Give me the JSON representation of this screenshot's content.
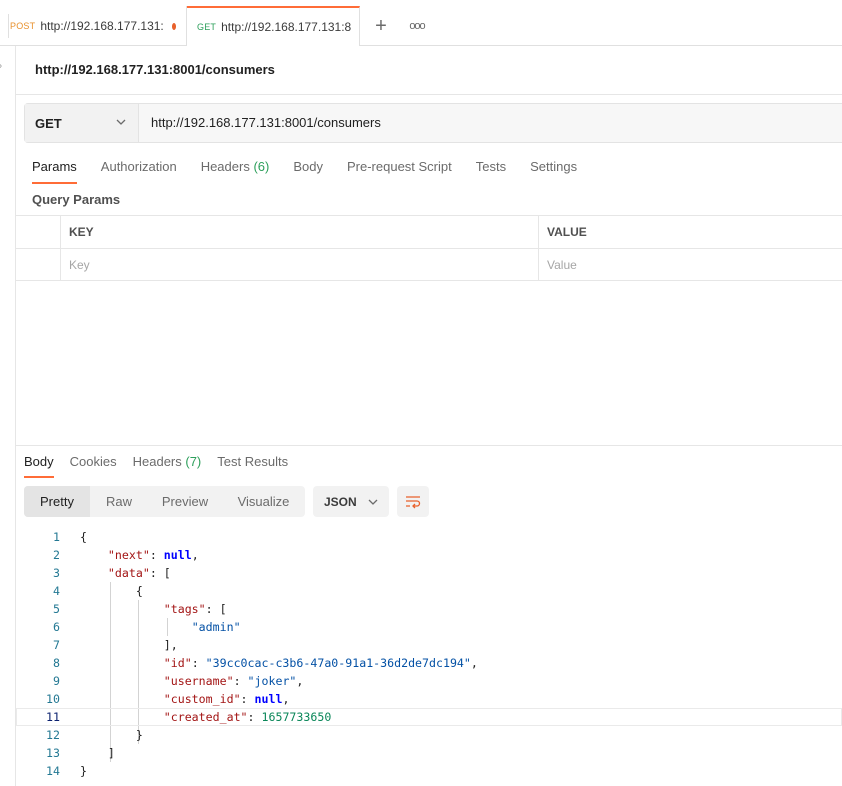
{
  "tabs": [
    {
      "method": "POST",
      "url": "http://192.168.177.131:",
      "unsaved": true
    },
    {
      "method": "GET",
      "url": "http://192.168.177.131:8",
      "unsaved": true
    }
  ],
  "tab_add_label": "+",
  "tab_more_label": "ooo",
  "request": {
    "title": "http://192.168.177.131:8001/consumers",
    "method": "GET",
    "url": "http://192.168.177.131:8001/consumers"
  },
  "request_tabs": {
    "params": "Params",
    "authorization": "Authorization",
    "headers": "Headers",
    "headers_count": "(6)",
    "body": "Body",
    "prerequest": "Pre-request Script",
    "tests": "Tests",
    "settings": "Settings"
  },
  "query_params": {
    "label": "Query Params",
    "key_header": "KEY",
    "value_header": "VALUE",
    "key_placeholder": "Key",
    "value_placeholder": "Value"
  },
  "response_tabs": {
    "body": "Body",
    "cookies": "Cookies",
    "headers": "Headers",
    "headers_count": "(7)",
    "test_results": "Test Results"
  },
  "view_modes": {
    "pretty": "Pretty",
    "raw": "Raw",
    "preview": "Preview",
    "visualize": "Visualize"
  },
  "format": "JSON",
  "colors": {
    "accent": "#ff6c37",
    "get": "#2d9f5b",
    "post": "#e8912d",
    "json_key": "#a31515",
    "json_string": "#0451a5",
    "json_number": "#098658",
    "json_keyword": "#0000ff"
  },
  "response_lines": [
    {
      "n": "1",
      "indent": "",
      "parts": [
        [
          "p",
          "{"
        ]
      ]
    },
    {
      "n": "2",
      "indent": "    ",
      "parts": [
        [
          "k",
          "\"next\""
        ],
        [
          "p",
          ": "
        ],
        [
          "kw",
          "null"
        ],
        [
          "p",
          ","
        ]
      ]
    },
    {
      "n": "3",
      "indent": "    ",
      "parts": [
        [
          "k",
          "\"data\""
        ],
        [
          "p",
          ": ["
        ]
      ]
    },
    {
      "n": "4",
      "indent": "        ",
      "parts": [
        [
          "p",
          "{"
        ]
      ]
    },
    {
      "n": "5",
      "indent": "            ",
      "parts": [
        [
          "k",
          "\"tags\""
        ],
        [
          "p",
          ": ["
        ]
      ]
    },
    {
      "n": "6",
      "indent": "                ",
      "parts": [
        [
          "s",
          "\"admin\""
        ]
      ]
    },
    {
      "n": "7",
      "indent": "            ",
      "parts": [
        [
          "p",
          "],"
        ]
      ]
    },
    {
      "n": "8",
      "indent": "            ",
      "parts": [
        [
          "k",
          "\"id\""
        ],
        [
          "p",
          ": "
        ],
        [
          "s",
          "\"39cc0cac-c3b6-47a0-91a1-36d2de7dc194\""
        ],
        [
          "p",
          ","
        ]
      ]
    },
    {
      "n": "9",
      "indent": "            ",
      "parts": [
        [
          "k",
          "\"username\""
        ],
        [
          "p",
          ": "
        ],
        [
          "s",
          "\"joker\""
        ],
        [
          "p",
          ","
        ]
      ]
    },
    {
      "n": "10",
      "indent": "            ",
      "parts": [
        [
          "k",
          "\"custom_id\""
        ],
        [
          "p",
          ": "
        ],
        [
          "kw",
          "null"
        ],
        [
          "p",
          ","
        ]
      ]
    },
    {
      "n": "11",
      "indent": "            ",
      "parts": [
        [
          "k",
          "\"created_at\""
        ],
        [
          "p",
          ": "
        ],
        [
          "n",
          "1657733650"
        ]
      ]
    },
    {
      "n": "12",
      "indent": "        ",
      "parts": [
        [
          "p",
          "}"
        ]
      ]
    },
    {
      "n": "13",
      "indent": "    ",
      "parts": [
        [
          "p",
          "]"
        ]
      ]
    },
    {
      "n": "14",
      "indent": "",
      "parts": [
        [
          "p",
          "}"
        ]
      ]
    }
  ]
}
